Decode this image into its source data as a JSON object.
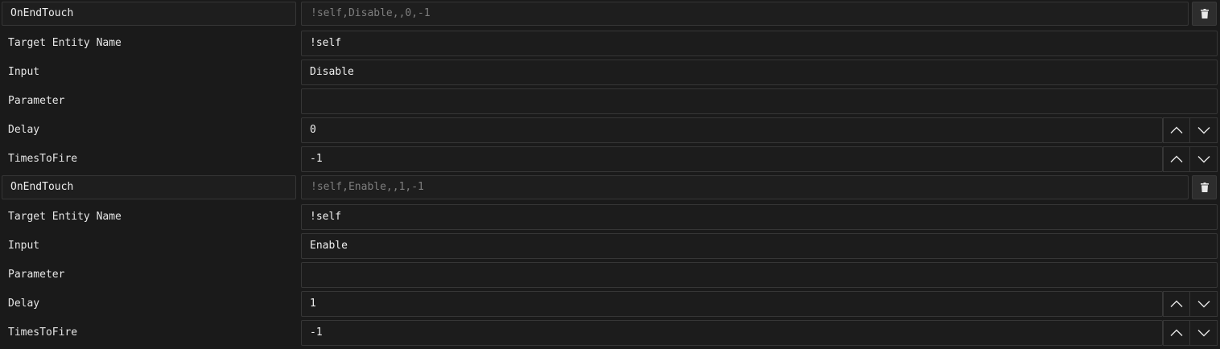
{
  "colors": {
    "background": "#1a1a1a",
    "field_border": "#363636",
    "summary_text": "#7e7e7e"
  },
  "outputs": [
    {
      "output_name": "OnEndTouch",
      "summary": "!self,Disable,,0,-1",
      "fields": {
        "target_label": "Target Entity Name",
        "target_value": "!self",
        "input_label": "Input",
        "input_value": "Disable",
        "parameter_label": "Parameter",
        "parameter_value": "",
        "delay_label": "Delay",
        "delay_value": "0",
        "times_label": "TimesToFire",
        "times_value": "-1"
      }
    },
    {
      "output_name": "OnEndTouch",
      "summary": "!self,Enable,,1,-1",
      "fields": {
        "target_label": "Target Entity Name",
        "target_value": "!self",
        "input_label": "Input",
        "input_value": "Enable",
        "parameter_label": "Parameter",
        "parameter_value": "",
        "delay_label": "Delay",
        "delay_value": "1",
        "times_label": "TimesToFire",
        "times_value": "-1"
      }
    }
  ]
}
